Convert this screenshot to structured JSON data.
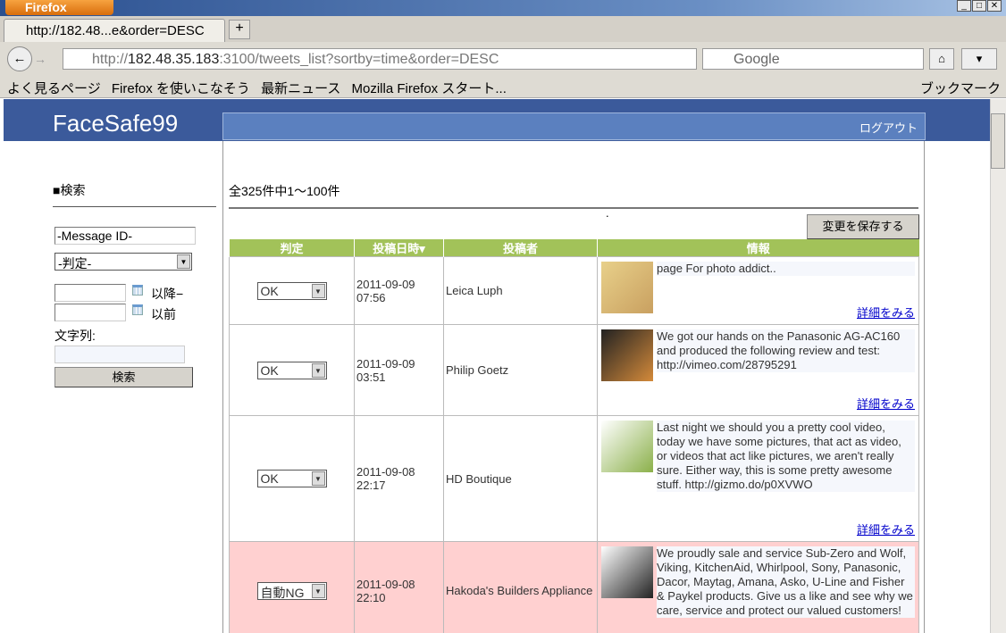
{
  "browser": {
    "app_button": "Firefox",
    "tab_title": "http://182.48...e&order=DESC",
    "url_prefix": "http://",
    "url_host": "182.48.35.183",
    "url_rest": ":3100/tweets_list?sortby=time&order=DESC",
    "search_placeholder": "Google",
    "bookmarks": [
      "よく見るページ",
      "Firefox を使いこなそう",
      "最新ニュース",
      "Mozilla Firefox スタート..."
    ],
    "bookmarks_menu": "ブックマーク"
  },
  "site": {
    "logo": "FaceSafe99",
    "logout": "ログアウト"
  },
  "search_panel": {
    "heading": "■検索",
    "message_id": "-Message ID-",
    "judgment_select": "-判定-",
    "after_label": "以降−",
    "before_label": "以前",
    "string_label": "文字列:",
    "search_button": "検索"
  },
  "main": {
    "count": "全325件中1～100件",
    "dot": ".",
    "save_button": "変更を保存する",
    "columns": [
      "判定",
      "投稿日時▾",
      "投稿者",
      "情報"
    ],
    "rows": [
      {
        "judgment": "OK",
        "date": "2011-09-09",
        "time": "07:56",
        "poster": "Leica Luph",
        "text": "page For photo addict..",
        "more": "詳細をみる",
        "ng": false
      },
      {
        "judgment": "OK",
        "date": "2011-09-09",
        "time": "03:51",
        "poster": "Philip Goetz",
        "text": "We got our hands on the Panasonic AG-AC160 and produced the following review and test: http://vimeo.com/28795291",
        "more": "詳細をみる",
        "ng": false
      },
      {
        "judgment": "OK",
        "date": "2011-09-08",
        "time": "22:17",
        "poster": "HD Boutique",
        "text": "Last night we should you a pretty cool video, today we have some pictures, that act as video, or videos that act like pictures, we aren't really sure. Either way, this is some pretty awesome stuff. http://gizmo.do/p0XVWO",
        "more": "詳細をみる",
        "ng": false
      },
      {
        "judgment": "自動NG",
        "date": "2011-09-08",
        "time": "22:10",
        "poster": "Hakoda's Builders Appliance",
        "text": "We proudly sale and service Sub-Zero and Wolf, Viking, KitchenAid, Whirlpool, Sony, Panasonic, Dacor, Maytag, Amana, Asko, U-Line and Fisher & Paykel products. Give us a like and see why we care, service and protect our valued customers!",
        "more": "",
        "ng": true
      }
    ]
  }
}
